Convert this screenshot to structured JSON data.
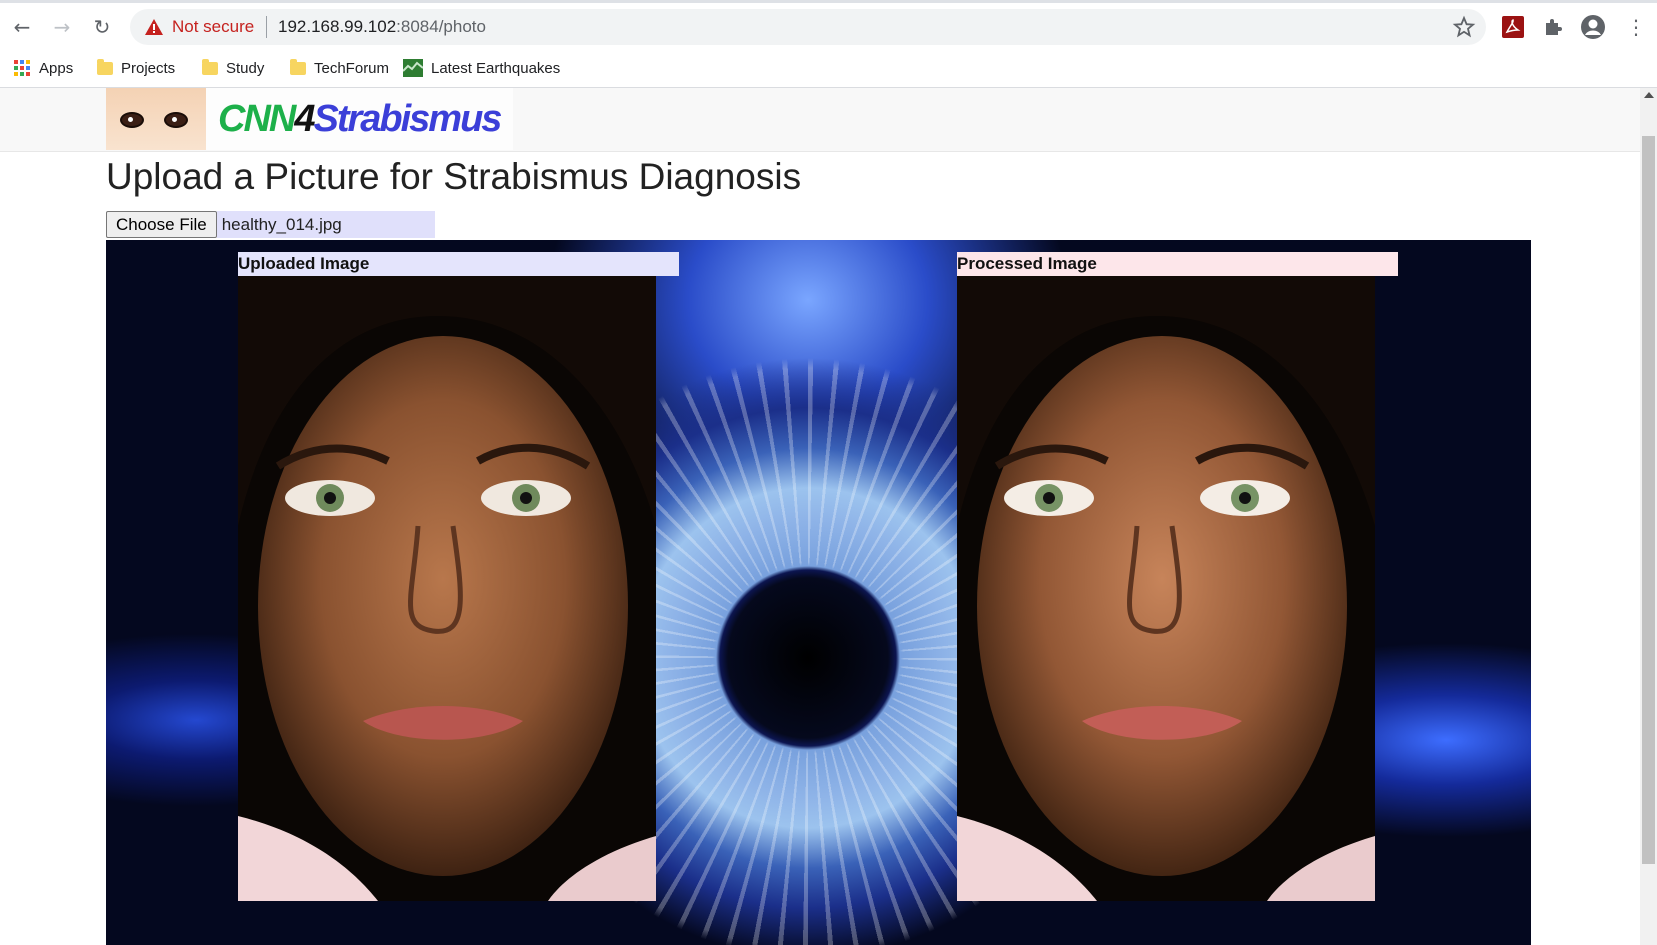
{
  "browser": {
    "security_label": "Not secure",
    "url_host": "192.168.99.102",
    "url_path": ":8084/photo",
    "bookmarks": [
      {
        "label": "Apps",
        "icon": "apps-grid-icon"
      },
      {
        "label": "Projects",
        "icon": "folder-icon"
      },
      {
        "label": "Study",
        "icon": "folder-icon"
      },
      {
        "label": "TechForum",
        "icon": "folder-icon"
      },
      {
        "label": "Latest Earthquakes",
        "icon": "earthquake-map-icon"
      }
    ]
  },
  "page": {
    "logo": {
      "part1": "CNN",
      "part2": "4",
      "part3": "Strabismus"
    },
    "title": "Upload a Picture for Strabismus Diagnosis",
    "file_input": {
      "button_label": "Choose File",
      "file_name": "healthy_014.jpg"
    },
    "uploaded_label": "Uploaded Image",
    "processed_label": "Processed Image"
  },
  "colors": {
    "not_secure": "#c5221f",
    "logo_green": "#1db04a",
    "logo_blue": "#3b3fd8",
    "uploaded_label_bg": "#e4e4fc",
    "processed_label_bg": "#fde6ea"
  }
}
